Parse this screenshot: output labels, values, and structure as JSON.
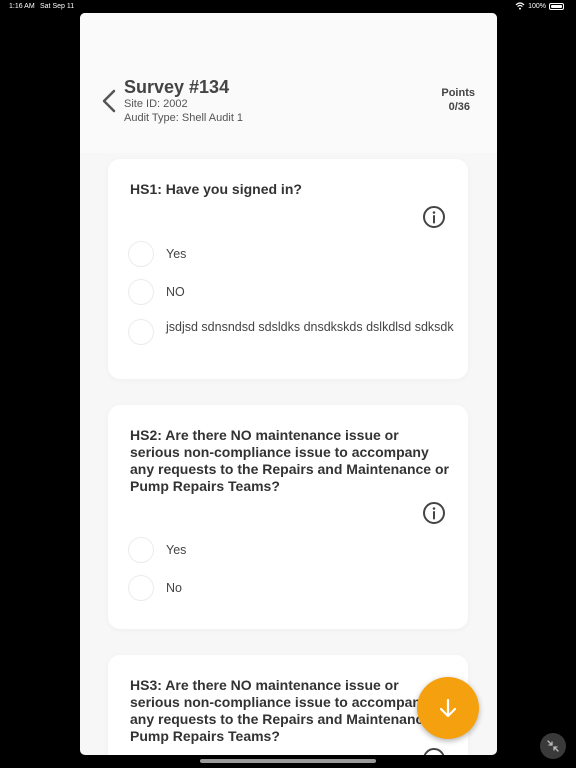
{
  "status_bar": {
    "time": "1:16 AM",
    "date": "Sat Sep 11",
    "battery": "100%"
  },
  "header": {
    "title": "Survey #134",
    "site_id": "Site ID: 2002",
    "audit_type": "Audit Type: Shell Audit 1",
    "points_label": "Points",
    "points_value": "0/36"
  },
  "questions": [
    {
      "text": "HS1: Have you signed in?",
      "options": [
        "Yes",
        "NO",
        "jsdjsd sdnsndsd sdsldks dnsdkskds dslkdlsd sdksdk"
      ]
    },
    {
      "text": "HS2: Are there NO maintenance issue or serious non-compliance issue to accompany any requests to the Repairs and Maintenance or Pump Repairs Teams?",
      "options": [
        "Yes",
        "No"
      ]
    },
    {
      "text": "HS3: Are there NO maintenance issue or serious non-compliance issue to accompany any requests to the Repairs and Maintenance or Pump Repairs Teams?",
      "options": []
    }
  ],
  "icons": {
    "back": "chevron-left-icon",
    "info": "info-icon",
    "fab": "arrow-down-icon",
    "compress": "compress-icon"
  },
  "colors": {
    "accent": "#f5a10f",
    "sheet_bg": "#f7f7f7",
    "card_bg": "#ffffff",
    "text": "#333333"
  }
}
